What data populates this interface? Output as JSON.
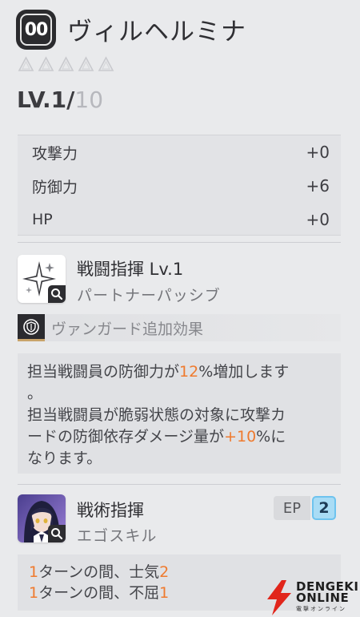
{
  "header": {
    "rank_badge": "00",
    "name": "ヴィルヘルミナ",
    "stars_filled": 0,
    "stars_total": 5,
    "level_current": "LV.1/",
    "level_max": "10"
  },
  "stats": [
    {
      "label": "攻撃力",
      "value": "+0"
    },
    {
      "label": "防御力",
      "value": "+6"
    },
    {
      "label": "HP",
      "value": "+0"
    }
  ],
  "skill1": {
    "icon": "sparkle-icon",
    "title": "戦闘指揮 Lv.1",
    "subtitle": "パートナーパッシブ",
    "vanguard_label": "ヴァンガード追加効果",
    "desc_line1_a": "担当戦闘員の防御力が",
    "desc_line1_num": "12",
    "desc_line1_b": "%増加します",
    "desc_line2": "。",
    "desc_line3": "担当戦闘員が脆弱状態の対象に攻撃カ",
    "desc_line4_a": "ードの防御依存ダメージ量が",
    "desc_line4_num": "+10",
    "desc_line4_b": "%に",
    "desc_line5": "なります。"
  },
  "skill2": {
    "icon": "character-portrait",
    "title": "戦術指揮",
    "subtitle": "エゴスキル",
    "ep_label": "EP",
    "ep_value": "2",
    "line1_num": "1",
    "line1_text": "ターンの間、士気",
    "line1_val": "2",
    "line2_num": "1",
    "line2_text": "ターンの間、不屈",
    "line2_val": "1"
  },
  "watermark": {
    "line1": "DENGEKI",
    "line2": "ONLINE",
    "line3": "電撃オンライン"
  },
  "colors": {
    "accent_orange": "#ef7a2e",
    "ep_blue": "#a9dcf5",
    "watermark_red": "#e1251b"
  }
}
